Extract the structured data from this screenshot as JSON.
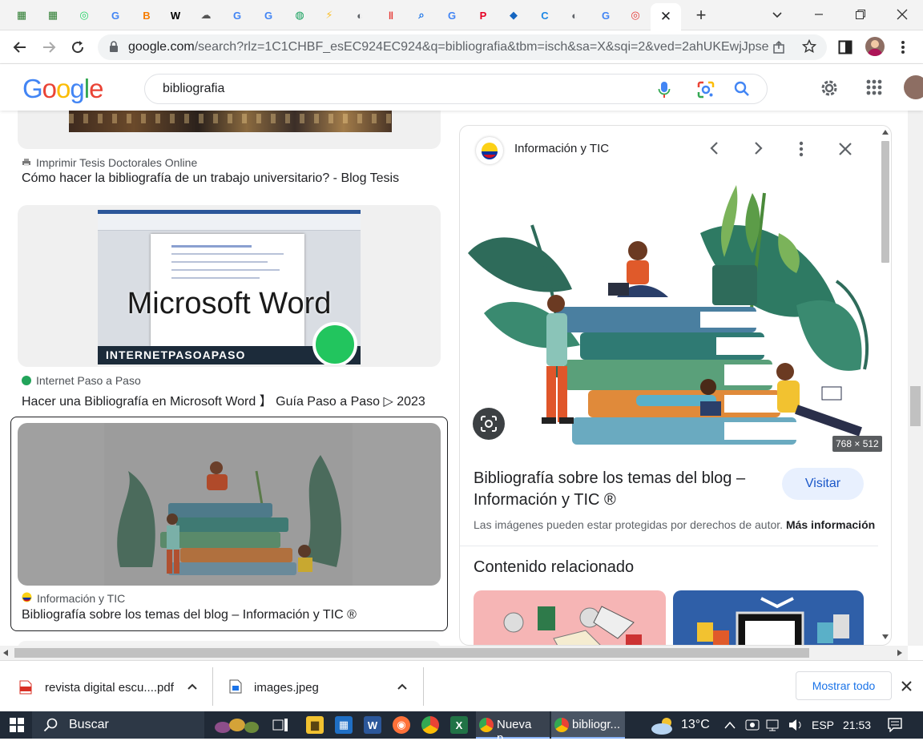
{
  "browser": {
    "tabs": [
      {
        "icon": "grid-apps-icon",
        "color": "#2e7d32"
      },
      {
        "icon": "grid-apps-icon",
        "color": "#2e7d32"
      },
      {
        "icon": "whatsapp-icon",
        "color": "#25d366"
      },
      {
        "icon": "google-icon",
        "color": "#4285f4"
      },
      {
        "icon": "blogger-icon",
        "color": "#f57c00"
      },
      {
        "icon": "wikipedia-icon",
        "color": "#000000"
      },
      {
        "icon": "cloud-icon",
        "color": "#555555"
      },
      {
        "icon": "google-icon",
        "color": "#4285f4"
      },
      {
        "icon": "google-icon",
        "color": "#4285f4"
      },
      {
        "icon": "globe-icon",
        "color": "#0f9d58"
      },
      {
        "icon": "lightning-icon",
        "color": "#fbc02d"
      },
      {
        "icon": "page-icon",
        "color": "#5f6368"
      },
      {
        "icon": "bars-icon",
        "color": "#e53935"
      },
      {
        "icon": "lens-icon",
        "color": "#1a73e8"
      },
      {
        "icon": "google-icon",
        "color": "#4285f4"
      },
      {
        "icon": "pinterest-icon",
        "color": "#e60023"
      },
      {
        "icon": "diamond-icon",
        "color": "#1565c0"
      },
      {
        "icon": "c-logo-icon",
        "color": "#1e88e5"
      },
      {
        "icon": "page-icon",
        "color": "#5f6368"
      },
      {
        "icon": "google-icon",
        "color": "#4285f4"
      },
      {
        "icon": "target-icon",
        "color": "#e53935"
      }
    ],
    "active_tab_close": "✕",
    "new_tab": "+",
    "url_host": "google.com",
    "url_rest": "/search?rlz=1C1CHBF_esEC924EC924&q=bibliografia&tbm=isch&sa=X&sqi=2&ved=2ahUKEwjJpse..."
  },
  "google": {
    "logo": [
      "G",
      "o",
      "o",
      "g",
      "l",
      "e"
    ],
    "logo_colors": [
      "#4285f4",
      "#ea4335",
      "#fbbc05",
      "#4285f4",
      "#34a853",
      "#ea4335"
    ],
    "query": "bibliografia"
  },
  "results": [
    {
      "source": "Imprimir Tesis Doctorales Online",
      "title": "Cómo hacer la bibliografía de un trabajo universitario? - Blog Tesis"
    },
    {
      "source": "Internet Paso a Paso",
      "title": "Hacer una Bibliografía en Microsoft Word 】 Guía Paso a Paso ▷ 2023",
      "thumb_text": "Microsoft Word",
      "thumb_banner": "INTERNETPASOAPASO"
    },
    {
      "source": "Información y TIC",
      "title": "Bibliografía sobre los temas del blog – Información y TIC ®"
    }
  ],
  "panel": {
    "site_name": "Información y TIC",
    "image_size": "768 × 512",
    "title_line1": "Bibliografía sobre los temas del blog –",
    "title_line2": "Información y TIC ®",
    "visit_label": "Visitar",
    "copyright_text": "Las imágenes pueden estar protegidas por derechos de autor.",
    "more_info": "Más información",
    "related_heading": "Contenido relacionado"
  },
  "downloads": {
    "items": [
      {
        "name": "revista digital escu....pdf",
        "icon": "pdf-icon"
      },
      {
        "name": "images.jpeg",
        "icon": "image-file-icon"
      }
    ],
    "show_all": "Mostrar todo"
  },
  "taskbar": {
    "search_label": "Buscar",
    "apps": [
      {
        "label": "Nueva p...",
        "icon": "chrome-icon"
      },
      {
        "label": "bibliogr...",
        "icon": "chrome-icon"
      }
    ],
    "temperature": "13°C",
    "language": "ESP",
    "time": "21:53"
  }
}
